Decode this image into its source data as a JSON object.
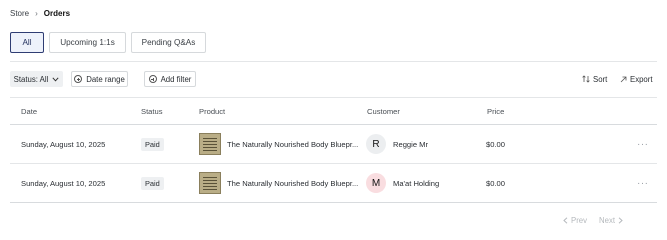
{
  "breadcrumb": {
    "parent": "Store",
    "separator": "›",
    "current": "Orders"
  },
  "tabs": [
    {
      "label": "All",
      "active": true
    },
    {
      "label": "Upcoming 1:1s",
      "active": false
    },
    {
      "label": "Pending Q&As",
      "active": false
    }
  ],
  "filters": {
    "status_label": "Status: All",
    "date_range_label": "Date range",
    "add_filter_label": "Add filter"
  },
  "actions": {
    "sort_label": "Sort",
    "export_label": "Export"
  },
  "table": {
    "columns": [
      "Date",
      "Status",
      "Product",
      "Customer",
      "Price"
    ],
    "rows": [
      {
        "date": "Sunday, August 10, 2025",
        "status": "Paid",
        "product": "The Naturally Nourished Body Bluepr...",
        "customer_initial": "R",
        "customer": "Reggie Mr",
        "avatar_color": "#eceef0",
        "price": "$0.00",
        "more": "···"
      },
      {
        "date": "Sunday, August 10, 2025",
        "status": "Paid",
        "product": "The Naturally Nourished Body Bluepr...",
        "customer_initial": "M",
        "customer": "Ma'at Holding",
        "avatar_color": "#f9dde0",
        "price": "$0.00",
        "more": "···"
      }
    ]
  },
  "pagination": {
    "prev_label": "Prev",
    "next_label": "Next"
  },
  "colors": {
    "accent": "#2f3d73",
    "accent_bg": "#eef2fb",
    "border": "#d6d9dc",
    "muted": "#b5b9bd"
  }
}
